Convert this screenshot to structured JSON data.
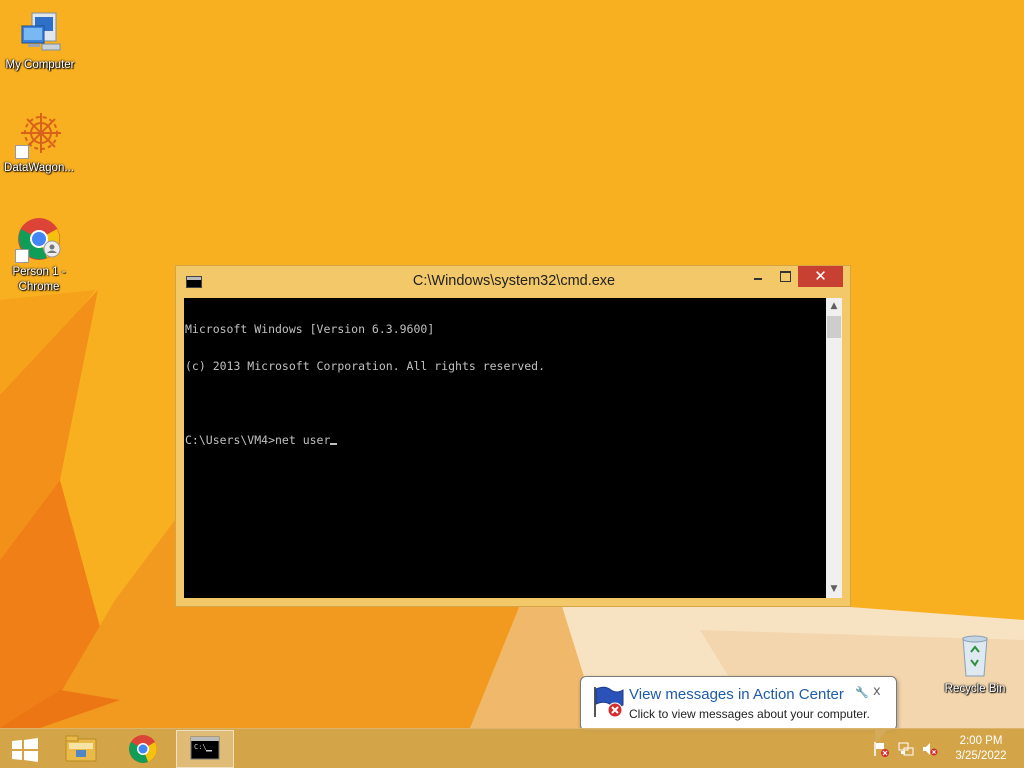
{
  "desktop": {
    "icons": [
      {
        "name": "my-computer",
        "label": "My Computer",
        "icon": "computer-icon"
      },
      {
        "name": "datawagon",
        "label": "DataWagon...",
        "icon": "datawagon-sun-icon"
      },
      {
        "name": "person1-chrome",
        "label_line1": "Person 1 -",
        "label_line2": "Chrome",
        "icon": "chrome-profile-icon"
      },
      {
        "name": "recycle-bin",
        "label": "Recycle Bin",
        "icon": "recycle-bin-icon"
      }
    ]
  },
  "cmd": {
    "title": "C:\\Windows\\system32\\cmd.exe",
    "close_glyph": "✕",
    "lines": [
      "Microsoft Windows [Version 6.3.9600]",
      "(c) 2013 Microsoft Corporation. All rights reserved.",
      "",
      "C:\\Users\\VM4>net user"
    ]
  },
  "balloon": {
    "title": "View messages in Action Center",
    "text": "Click to view messages about your computer.",
    "close_glyph": "x",
    "settings_glyph": "🔧"
  },
  "taskbar": {
    "items": [
      "start-button",
      "file-explorer",
      "chrome",
      "command-prompt"
    ],
    "active": "command-prompt",
    "tray": [
      "action-center-flag-icon",
      "network-icon",
      "volume-muted-icon"
    ]
  },
  "clock": {
    "time": "2:00 PM",
    "date": "3/25/2022"
  },
  "colors": {
    "wallpaper": "#f8b021",
    "window_frame": "#f3c869",
    "close_button": "#c74032",
    "console_bg": "#000000",
    "console_fg": "#c0c0c0",
    "balloon_title": "#1e5ba8"
  }
}
